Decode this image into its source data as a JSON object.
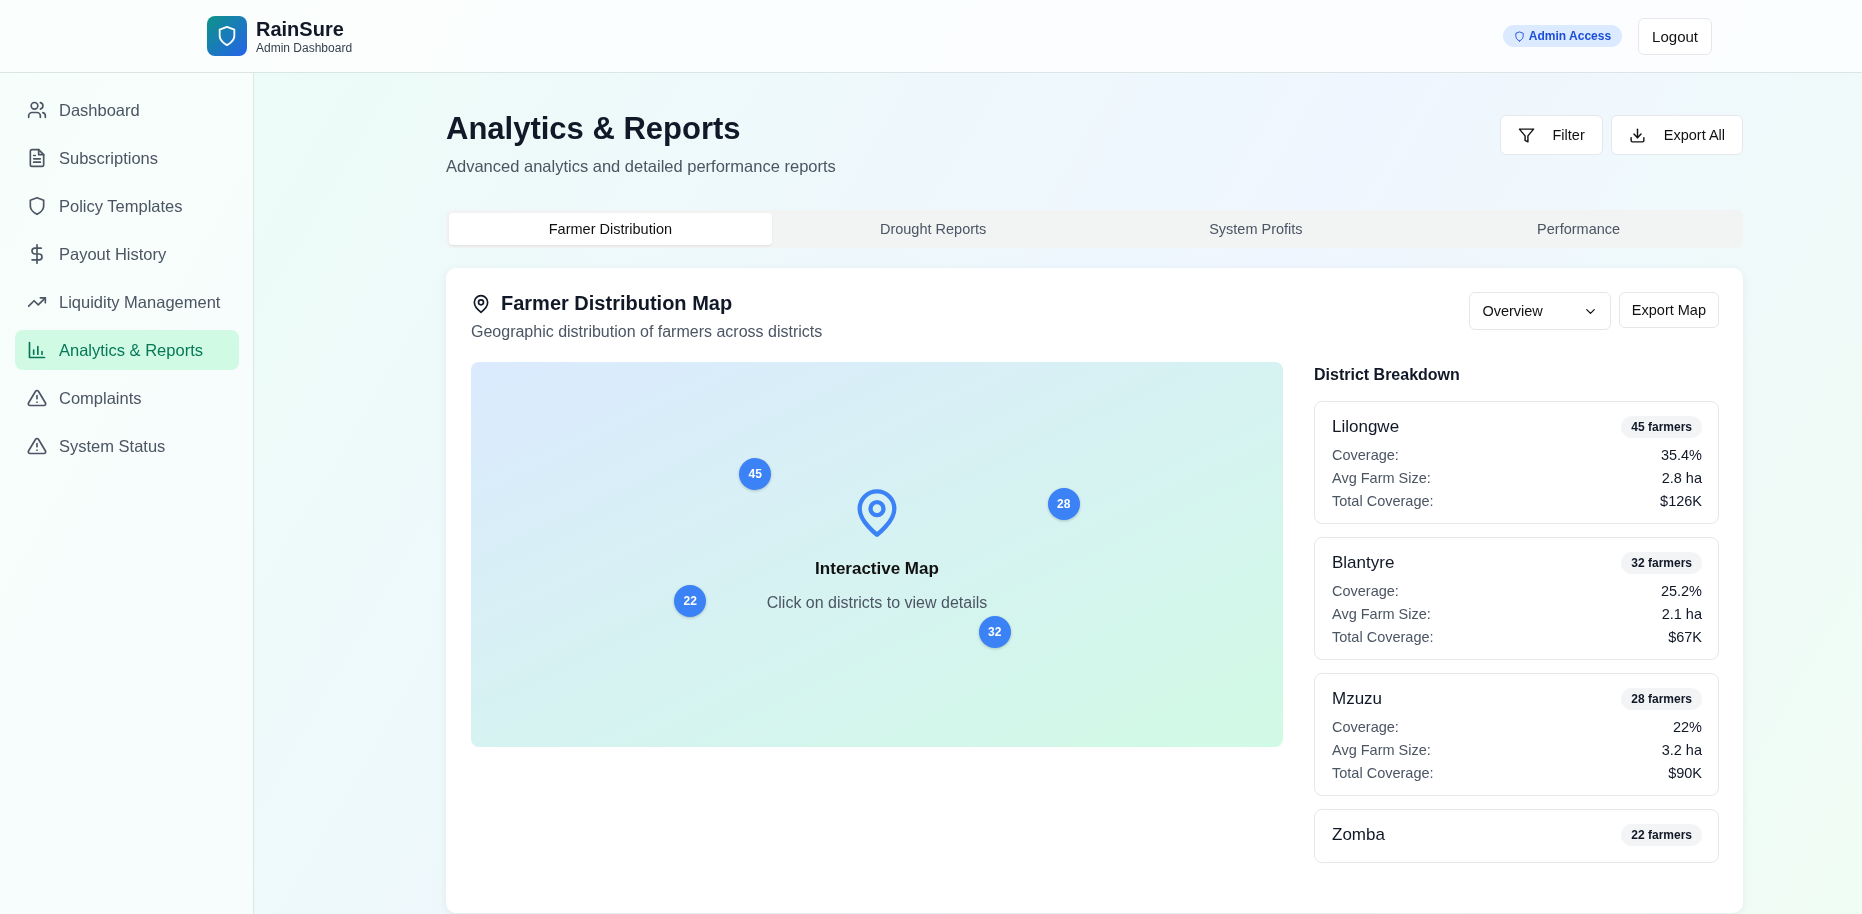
{
  "app": {
    "name": "RainSure",
    "subtitle": "Admin Dashboard",
    "access_badge": "Admin Access",
    "logout": "Logout"
  },
  "sidebar": {
    "items": [
      {
        "label": "Dashboard",
        "selected": false
      },
      {
        "label": "Subscriptions",
        "selected": false
      },
      {
        "label": "Policy Templates",
        "selected": false
      },
      {
        "label": "Payout History",
        "selected": false
      },
      {
        "label": "Liquidity Management",
        "selected": false
      },
      {
        "label": "Analytics & Reports",
        "selected": true
      },
      {
        "label": "Complaints",
        "selected": false
      },
      {
        "label": "System Status",
        "selected": false
      }
    ]
  },
  "page": {
    "title": "Analytics & Reports",
    "subtitle": "Advanced analytics and detailed performance reports",
    "buttons": [
      {
        "label": "Filter"
      },
      {
        "label": "Export All"
      }
    ]
  },
  "tabs": [
    {
      "label": "Farmer Distribution",
      "selected": true
    },
    {
      "label": "Drought Reports",
      "selected": false
    },
    {
      "label": "System Profits",
      "selected": false
    },
    {
      "label": "Performance",
      "selected": false
    }
  ],
  "map_card": {
    "title": "Farmer Distribution Map",
    "subtitle": "Geographic distribution of farmers across districts",
    "view_select": "Overview",
    "export": "Export Map",
    "map": {
      "title": "Interactive Map",
      "hint": "Click on districts to view details",
      "markers": [
        "45",
        "28",
        "22",
        "32"
      ]
    },
    "breakdown_title": "District Breakdown",
    "districts": [
      {
        "name": "Lilongwe",
        "badge": "45 farmers",
        "rows": [
          {
            "label": "Coverage:",
            "value": "35.4%"
          },
          {
            "label": "Avg Farm Size:",
            "value": "2.8 ha"
          },
          {
            "label": "Total Coverage:",
            "value": "$126K"
          }
        ]
      },
      {
        "name": "Blantyre",
        "badge": "32 farmers",
        "rows": [
          {
            "label": "Coverage:",
            "value": "25.2%"
          },
          {
            "label": "Avg Farm Size:",
            "value": "2.1 ha"
          },
          {
            "label": "Total Coverage:",
            "value": "$67K"
          }
        ]
      },
      {
        "name": "Mzuzu",
        "badge": "28 farmers",
        "rows": [
          {
            "label": "Coverage:",
            "value": "22%"
          },
          {
            "label": "Avg Farm Size:",
            "value": "3.2 ha"
          },
          {
            "label": "Total Coverage:",
            "value": "$90K"
          }
        ]
      },
      {
        "name": "Zomba",
        "badge": "22 farmers"
      }
    ]
  }
}
